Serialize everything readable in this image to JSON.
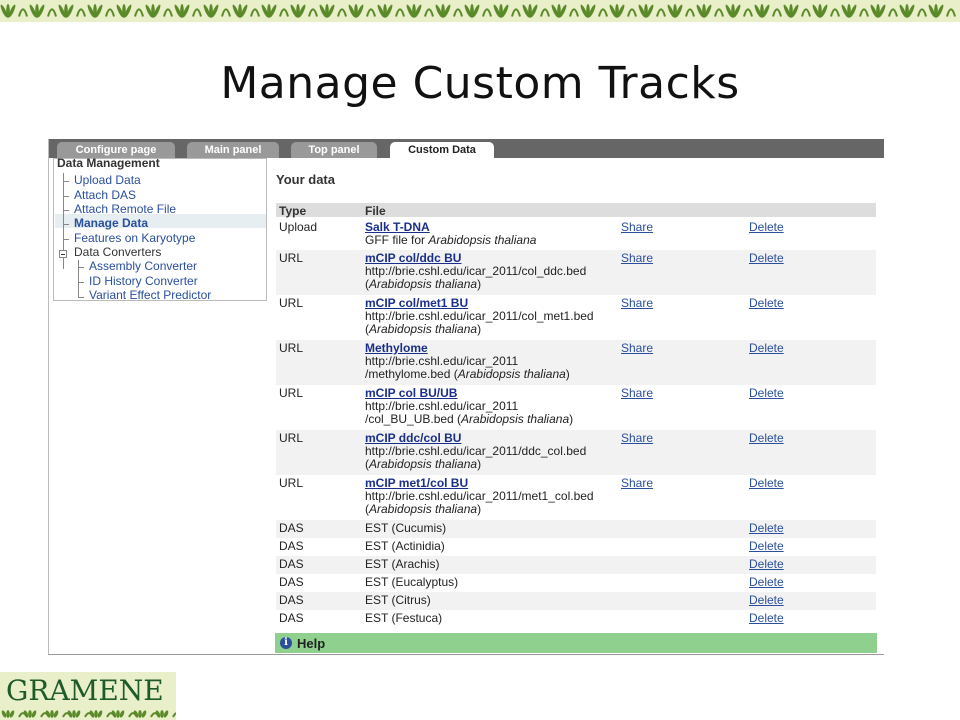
{
  "slide": {
    "title": "Manage Custom Tracks"
  },
  "colors": {
    "band": "#e9efc8",
    "leaf": "#5b8a2a",
    "link": "#2a4f9c",
    "tab_bar": "#666666",
    "help": "#8fd08f"
  },
  "tabs": [
    {
      "label": "Configure page",
      "active": false
    },
    {
      "label": "Main panel",
      "active": false
    },
    {
      "label": "Top panel",
      "active": false
    },
    {
      "label": "Custom Data",
      "active": true
    }
  ],
  "sidebar": {
    "header": "Data Management",
    "items": [
      {
        "label": "Upload Data"
      },
      {
        "label": "Attach DAS"
      },
      {
        "label": "Attach Remote File"
      },
      {
        "label": "Manage Data",
        "selected": true
      },
      {
        "label": "Features on Karyotype"
      },
      {
        "label": "Data Converters"
      },
      {
        "label": "Assembly Converter"
      },
      {
        "label": "ID History Converter"
      },
      {
        "label": "Variant Effect Predictor"
      }
    ]
  },
  "main": {
    "heading": "Your data",
    "columns": {
      "type": "Type",
      "file": "File"
    },
    "share_label": "Share",
    "delete_label": "Delete",
    "rows": [
      {
        "type": "Upload",
        "name": "Salk T-DNA",
        "desc1": "GFF file for ",
        "desc1_italic": "Arabidopsis thaliana",
        "desc2": "",
        "desc2_italic": ""
      },
      {
        "type": "URL",
        "name": "mCIP col/ddc BU",
        "desc1": "http://brie.cshl.edu/icar_2011/col_ddc.bed",
        "desc1_italic": "",
        "desc2": "(",
        "desc2_italic": "Arabidopsis thaliana"
      },
      {
        "type": "URL",
        "name": "mCIP col/met1 BU",
        "desc1": "http://brie.cshl.edu/icar_2011/col_met1.bed",
        "desc1_italic": "",
        "desc2": "(",
        "desc2_italic": "Arabidopsis thaliana"
      },
      {
        "type": "URL",
        "name": "Methylome",
        "desc1": "http://brie.cshl.edu/icar_2011",
        "desc1_italic": "",
        "desc2": "/methylome.bed (",
        "desc2_italic": "Arabidopsis thaliana"
      },
      {
        "type": "URL",
        "name": "mCIP col BU/UB",
        "desc1": "http://brie.cshl.edu/icar_2011",
        "desc1_italic": "",
        "desc2": "/col_BU_UB.bed (",
        "desc2_italic": "Arabidopsis thaliana"
      },
      {
        "type": "URL",
        "name": "mCIP ddc/col BU",
        "desc1": "http://brie.cshl.edu/icar_2011/ddc_col.bed",
        "desc1_italic": "",
        "desc2": "(",
        "desc2_italic": "Arabidopsis thaliana"
      },
      {
        "type": "URL",
        "name": "mCIP met1/col BU",
        "desc1": "http://brie.cshl.edu/icar_2011/met1_col.bed",
        "desc1_italic": "",
        "desc2": "(",
        "desc2_italic": "Arabidopsis thaliana"
      },
      {
        "type": "DAS",
        "plain": "EST (Cucumis)"
      },
      {
        "type": "DAS",
        "plain": "EST (Actinidia)"
      },
      {
        "type": "DAS",
        "plain": "EST (Arachis)"
      },
      {
        "type": "DAS",
        "plain": "EST (Eucalyptus)"
      },
      {
        "type": "DAS",
        "plain": "EST (Citrus)"
      },
      {
        "type": "DAS",
        "plain": "EST (Festuca)"
      }
    ],
    "help_label": "Help",
    "help_icon": "info-icon"
  },
  "logo": {
    "text": "GRAMENE"
  }
}
